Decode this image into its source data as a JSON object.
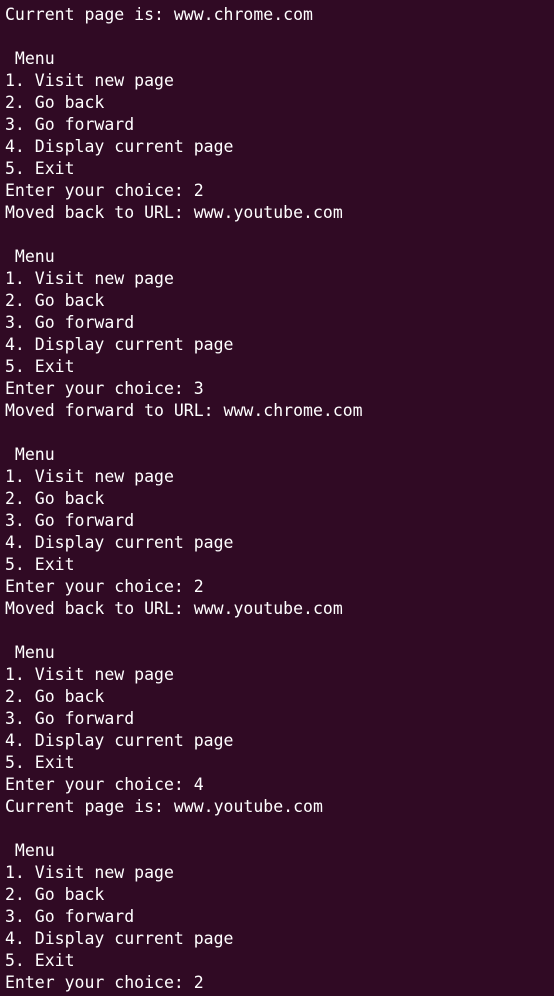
{
  "terminal": {
    "colors": {
      "background": "#300a24",
      "foreground": "#ffffff"
    },
    "lines": [
      "Current page is: www.chrome.com",
      "",
      " Menu",
      "1. Visit new page",
      "2. Go back",
      "3. Go forward",
      "4. Display current page",
      "5. Exit",
      "Enter your choice: 2",
      "Moved back to URL: www.youtube.com",
      "",
      " Menu",
      "1. Visit new page",
      "2. Go back",
      "3. Go forward",
      "4. Display current page",
      "5. Exit",
      "Enter your choice: 3",
      "Moved forward to URL: www.chrome.com",
      "",
      " Menu",
      "1. Visit new page",
      "2. Go back",
      "3. Go forward",
      "4. Display current page",
      "5. Exit",
      "Enter your choice: 2",
      "Moved back to URL: www.youtube.com",
      "",
      " Menu",
      "1. Visit new page",
      "2. Go back",
      "3. Go forward",
      "4. Display current page",
      "5. Exit",
      "Enter your choice: 4",
      "Current page is: www.youtube.com",
      "",
      " Menu",
      "1. Visit new page",
      "2. Go back",
      "3. Go forward",
      "4. Display current page",
      "5. Exit",
      "Enter your choice: 2"
    ]
  }
}
